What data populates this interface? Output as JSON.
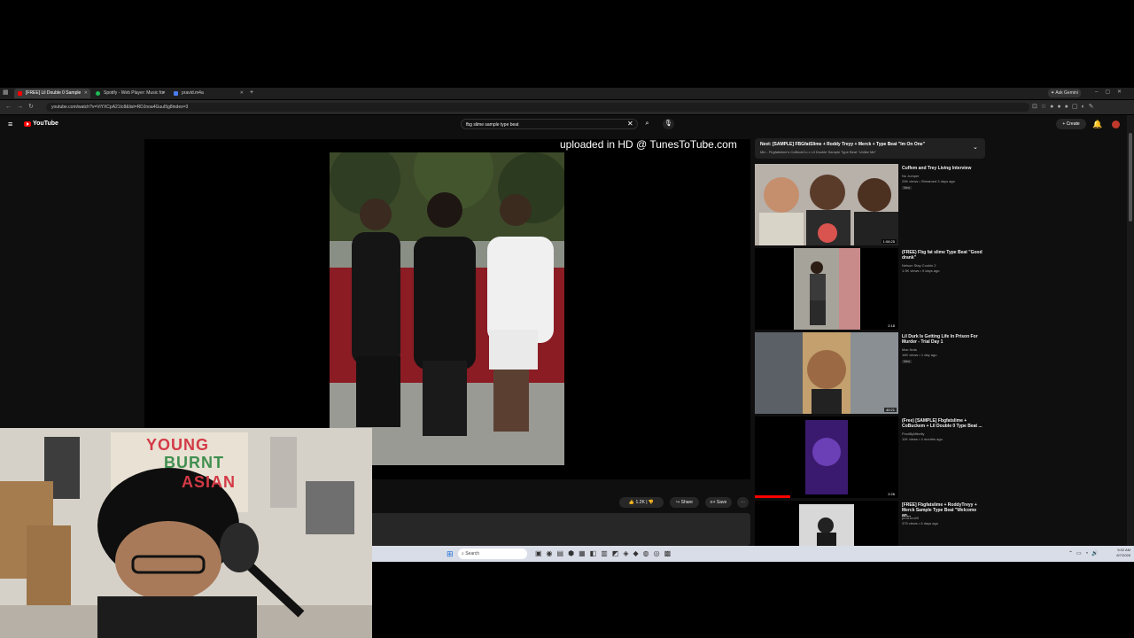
{
  "browser": {
    "tabs": [
      {
        "label": "[FREE] Lil Double 0 Sample",
        "active": true
      },
      {
        "label": "Spotify - Web Player: Music for",
        "active": false
      },
      {
        "label": "pravid.m4a",
        "active": false
      }
    ],
    "new_tab": "+",
    "gemini": "Ask Gemini",
    "url": "youtube.com/watch?v=ViYXCpA21Ic8&list=RDJnoa4GuuI5g8index=3"
  },
  "youtube": {
    "logo": "YouTube",
    "search_value": "fbg slime sample type beat",
    "create": "Create",
    "watermark": "uploaded in HD @ TunesToTube.com",
    "actions": {
      "likes": "1.2K",
      "share": "Share",
      "save": "Save"
    },
    "playlist": {
      "title": "Next: [SAMPLE] FBGfatSlime + Roddy Treyy + Merck + Type Beat \"Im On One\"",
      "subtitle": "Mix - Fbgfatslime's CoBuckCo x Lil Double Sample Type Beat \"Unlike Me\""
    },
    "related": [
      {
        "title": "Cuffem and Trey Living Interview",
        "channel": "No Jumper",
        "meta": "25K views • Streamed 3 days ago",
        "badge": "New",
        "duration": "1:06:25"
      },
      {
        "title": "(FREE) Fbg fat slime Type Beat \"Good drank\"",
        "channel": "Nelson Stay Cookin 2",
        "meta": "1.9K views • 9 days ago",
        "badge": "",
        "duration": "2:18"
      },
      {
        "title": "Lil Durk Is Getting Life In Prison For Murder - Trial Day 1",
        "channel": "Mac Nuts",
        "meta": "16K views • 1 day ago",
        "badge": "New",
        "duration": "40:21"
      },
      {
        "title": "(Free) [SAMPLE] Fbgfatslime + CoBuckem + Lil Double 0 Type Beat ...",
        "channel": "ProdByMikelly",
        "meta": "11K views • 4 months ago",
        "badge": "",
        "duration": "2:26"
      },
      {
        "title": "[FREE] Fbgfatslime + RoddyTreyy + Merck Sample Type Beat \"Welcome an...",
        "channel": "prod.kru00",
        "meta": "375 views • 6 days ago",
        "badge": "",
        "duration": ""
      }
    ]
  },
  "taskbar": {
    "search": "Search",
    "time": "5:02 AM",
    "date": "8/7/2026"
  },
  "webcam": {
    "sign_line1": "YOUNG",
    "sign_line2": "BURNT",
    "sign_line3": "ASIAN"
  }
}
